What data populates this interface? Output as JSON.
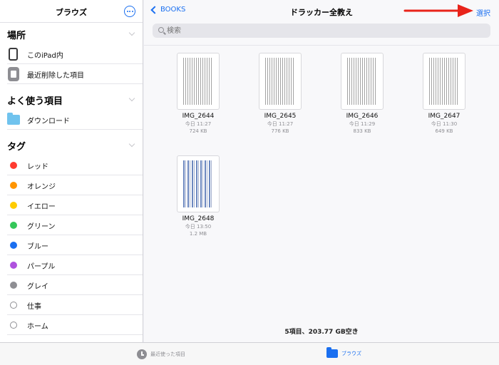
{
  "sidebar": {
    "title": "ブラウズ",
    "locations": {
      "title": "場所",
      "items": [
        {
          "label": "このiPad内",
          "icon": "ipad-icon"
        },
        {
          "label": "最近削除した項目",
          "icon": "trash-icon"
        }
      ]
    },
    "favorites": {
      "title": "よく使う項目",
      "items": [
        {
          "label": "ダウンロード",
          "icon": "folder-icon"
        }
      ]
    },
    "tags": {
      "title": "タグ",
      "items": [
        {
          "label": "レッド",
          "color": "#ff3b30"
        },
        {
          "label": "オレンジ",
          "color": "#ff9500"
        },
        {
          "label": "イエロー",
          "color": "#ffcc00"
        },
        {
          "label": "グリーン",
          "color": "#34c759"
        },
        {
          "label": "ブルー",
          "color": "#1a6ff0"
        },
        {
          "label": "パープル",
          "color": "#af52de"
        },
        {
          "label": "グレイ",
          "color": "#8e8e93"
        },
        {
          "label": "仕事",
          "color": ""
        },
        {
          "label": "ホーム",
          "color": ""
        }
      ]
    }
  },
  "nav": {
    "back_label": "BOOKS",
    "title": "ドラッカー全教え",
    "select_label": "選択"
  },
  "search": {
    "placeholder": "検索"
  },
  "files": [
    {
      "name": "IMG_2644",
      "date": "今日 11:27",
      "size": "724 KB"
    },
    {
      "name": "IMG_2645",
      "date": "今日 11:27",
      "size": "776 KB"
    },
    {
      "name": "IMG_2646",
      "date": "今日 11:29",
      "size": "833 KB"
    },
    {
      "name": "IMG_2647",
      "date": "今日 11:30",
      "size": "649 KB"
    },
    {
      "name": "IMG_2648",
      "date": "今日 13:50",
      "size": "1.2 MB"
    }
  ],
  "status": "5項目、203.77 GB空き",
  "tabbar": {
    "recents_label": "最近使った項目",
    "browse_label": "ブラウズ"
  },
  "colors": {
    "accent": "#1a6ff0",
    "annotation_arrow": "#e8231a"
  }
}
